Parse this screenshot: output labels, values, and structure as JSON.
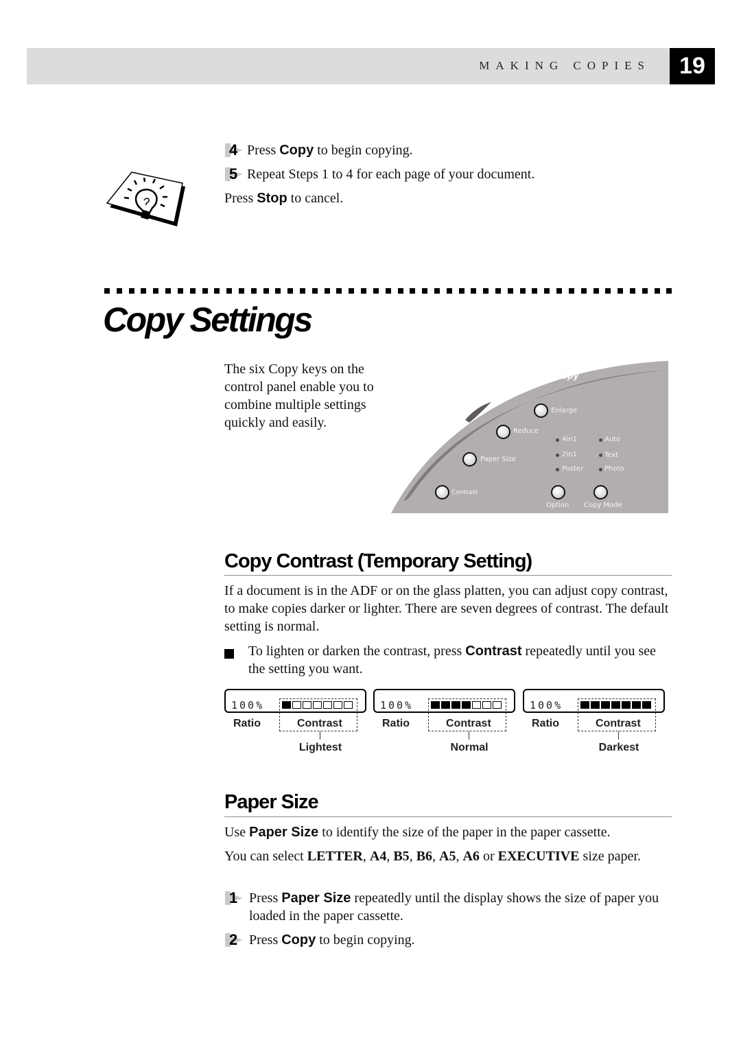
{
  "header": {
    "running_title": "MAKING COPIES",
    "page_number": "19"
  },
  "tip": {
    "icon": "lightbulb-tip-icon",
    "steps": [
      {
        "number": "4",
        "pre": "Press ",
        "key": "Copy",
        "post": " to begin copying."
      },
      {
        "number": "5",
        "text": "Repeat Steps 1 to 4 for each page of your document."
      }
    ],
    "cancel": {
      "pre": "Press ",
      "key": "Stop",
      "post": " to cancel."
    }
  },
  "title": "Copy Settings",
  "intro": "The six Copy keys on the control panel enable you to combine multiple settings quickly and easily.",
  "control_panel": {
    "heading": "Copy",
    "buttons": [
      "Enlarge",
      "Reduce",
      "Paper Size",
      "Contrast",
      "Option",
      "Copy Mode"
    ],
    "leds_left": [
      "4in1",
      "2in1",
      "Poster"
    ],
    "leds_right": [
      "Auto",
      "Text",
      "Photo"
    ],
    "colors": {
      "panel": "#b2adb0",
      "groove": "#7f7b7e",
      "label": "#f4f4f4"
    }
  },
  "contrast_section": {
    "heading": "Copy Contrast (Temporary Setting)",
    "paragraph": "If a document is in the ADF or on the glass platten, you can adjust copy contrast, to make copies darker or lighter. There are seven degrees of contrast. The default setting is normal.",
    "bullet": {
      "pre": "To lighten or darken the contrast, press ",
      "key": "Contrast",
      "post": " repeatedly until you see the setting you want."
    },
    "displays": [
      {
        "ratio": "100%",
        "level": 1,
        "total": 7,
        "ratio_label": "Ratio",
        "contrast_label": "Contrast",
        "caption": "Lightest"
      },
      {
        "ratio": "100%",
        "level": 4,
        "total": 7,
        "ratio_label": "Ratio",
        "contrast_label": "Contrast",
        "caption": "Normal"
      },
      {
        "ratio": "100%",
        "level": 7,
        "total": 7,
        "ratio_label": "Ratio",
        "contrast_label": "Contrast",
        "caption": "Darkest"
      }
    ]
  },
  "paper_section": {
    "heading": "Paper Size",
    "line1": {
      "pre": "Use ",
      "key": "Paper Size",
      "post": " to identify the size of the paper in the paper cassette."
    },
    "line2": {
      "pre": "You can select ",
      "sizes": [
        "LETTER",
        "A4",
        "B5",
        "B6",
        "A5",
        "A6"
      ],
      "or": " or ",
      "last": "EXECUTIVE",
      "post": " size paper."
    },
    "steps": [
      {
        "number": "1",
        "pre": "Press ",
        "key": "Paper Size",
        "post": " repeatedly until the display shows the size of paper you loaded in the paper cassette."
      },
      {
        "number": "2",
        "pre": "Press ",
        "key": "Copy",
        "post": " to begin copying."
      }
    ]
  }
}
